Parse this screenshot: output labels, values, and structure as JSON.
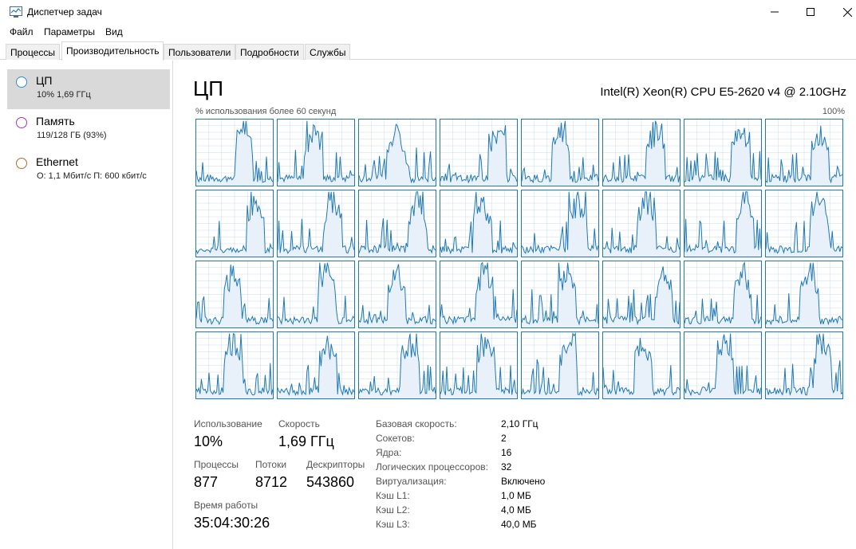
{
  "window": {
    "title": "Диспетчер задач",
    "icon": "task-manager-icon"
  },
  "menu": [
    "Файл",
    "Параметры",
    "Вид"
  ],
  "tabs": [
    "Процессы",
    "Производительность",
    "Пользователи",
    "Подробности",
    "Службы"
  ],
  "active_tab": "Производительность",
  "sidebar": {
    "items": [
      {
        "name": "ЦП",
        "sub": "10%  1,69 ГГц",
        "color": "#3a8cc7",
        "selected": true
      },
      {
        "name": "Память",
        "sub": "119/128 ГБ (93%)",
        "color": "#9b3ab1",
        "selected": false
      },
      {
        "name": "Ethernet",
        "sub": "О: 1,1 Мбит/с П: 600 кбит/с",
        "color": "#b56a2a",
        "selected": false
      }
    ]
  },
  "main": {
    "title": "ЦП",
    "cpu_model": "Intel(R) Xeon(R) CPU E5-2620 v4 @ 2.10GHz",
    "graph_label": "% использования более 60 секунд",
    "graph_max": "100%",
    "logical_graphs": 32,
    "accent_color": "#1f78b4",
    "fill_color": "#e8f1fa",
    "grid_color": "#c8dcec"
  },
  "stats": {
    "usage_label": "Использование",
    "usage_value": "10%",
    "speed_label": "Скорость",
    "speed_value": "1,69 ГГц",
    "processes_label": "Процессы",
    "processes_value": "877",
    "threads_label": "Потоки",
    "threads_value": "8712",
    "handles_label": "Дескрипторы",
    "handles_value": "543860",
    "uptime_label": "Время работы",
    "uptime_value": "35:04:30:26"
  },
  "details": [
    {
      "label": "Базовая скорость:",
      "value": "2,10 ГГц"
    },
    {
      "label": "Сокетов:",
      "value": "2"
    },
    {
      "label": "Ядра:",
      "value": "16"
    },
    {
      "label": "Логических процессоров:",
      "value": "32"
    },
    {
      "label": "Виртуализация:",
      "value": "Включено"
    },
    {
      "label": "Кэш L1:",
      "value": "1,0 МБ"
    },
    {
      "label": "Кэш L2:",
      "value": "4,0 МБ"
    },
    {
      "label": "Кэш L3:",
      "value": "40,0 МБ"
    }
  ]
}
